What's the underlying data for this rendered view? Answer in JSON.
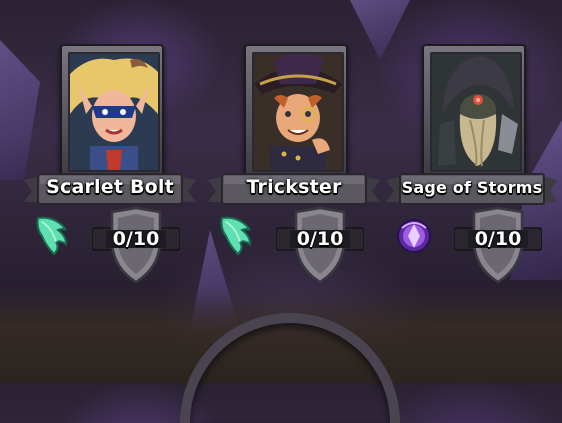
{
  "heroes": [
    {
      "name": "Scarlet Bolt",
      "progress": "0/10",
      "element_icon": "green-wing-icon",
      "portrait": "blonde-masked-hero-portrait"
    },
    {
      "name": "Trickster",
      "progress": "0/10",
      "element_icon": "green-wing-icon",
      "portrait": "pirate-monocle-hero-portrait"
    },
    {
      "name": "Sage of Storms",
      "progress": "0/10",
      "element_icon": "purple-magic-orb-icon",
      "portrait": "hooded-bearded-sage-portrait"
    }
  ],
  "colors": {
    "wing_green": "#5fe0b0",
    "magic_purple": "#a05ae8",
    "banner_gray": "#5b5860",
    "shield_gray": "#8a8690"
  }
}
